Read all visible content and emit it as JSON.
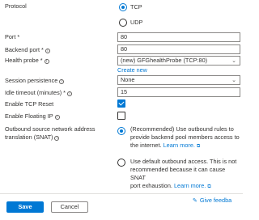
{
  "protocol": {
    "label": "Protocol",
    "options": [
      {
        "label": "TCP",
        "selected": true
      },
      {
        "label": "UDP",
        "selected": false
      }
    ]
  },
  "port": {
    "label": "Port *",
    "value": "80"
  },
  "backend_port": {
    "label": "Backend port *",
    "value": "80"
  },
  "health_probe": {
    "label": "Health probe *",
    "value": "(new) GFGhealthProbe (TCP:80)",
    "create_new": "Create new"
  },
  "session_persistence": {
    "label": "Session persistence",
    "value": "None"
  },
  "idle_timeout": {
    "label": "Idle timeout (minutes) *",
    "value": "15"
  },
  "tcp_reset": {
    "label": "Enable TCP Reset",
    "checked": true
  },
  "floating_ip": {
    "label": "Enable Floating IP",
    "checked": false
  },
  "snat": {
    "label_line1": "Outbound source network address",
    "label_line2": "translation (SNAT)",
    "options": [
      {
        "selected": true,
        "line1": "(Recommended) Use outbound rules to",
        "line2": "provide backend pool members access to",
        "line3": "the internet.",
        "link": "Learn more."
      },
      {
        "selected": false,
        "line1": "Use default outbound access. This is not",
        "line2": "recommended because it can cause SNAT",
        "line3": "port exhaustion.",
        "link": "Learn more."
      }
    ]
  },
  "footer": {
    "save": "Save",
    "cancel": "Cancel",
    "feedback": "Give feedba"
  },
  "icons": {
    "info": "info-icon",
    "external": "external-link-icon",
    "feedback": "feedback-icon",
    "chevron": "chevron-down-icon"
  },
  "colors": {
    "accent": "#0078d4",
    "text": "#323130",
    "border": "#8a8886"
  }
}
